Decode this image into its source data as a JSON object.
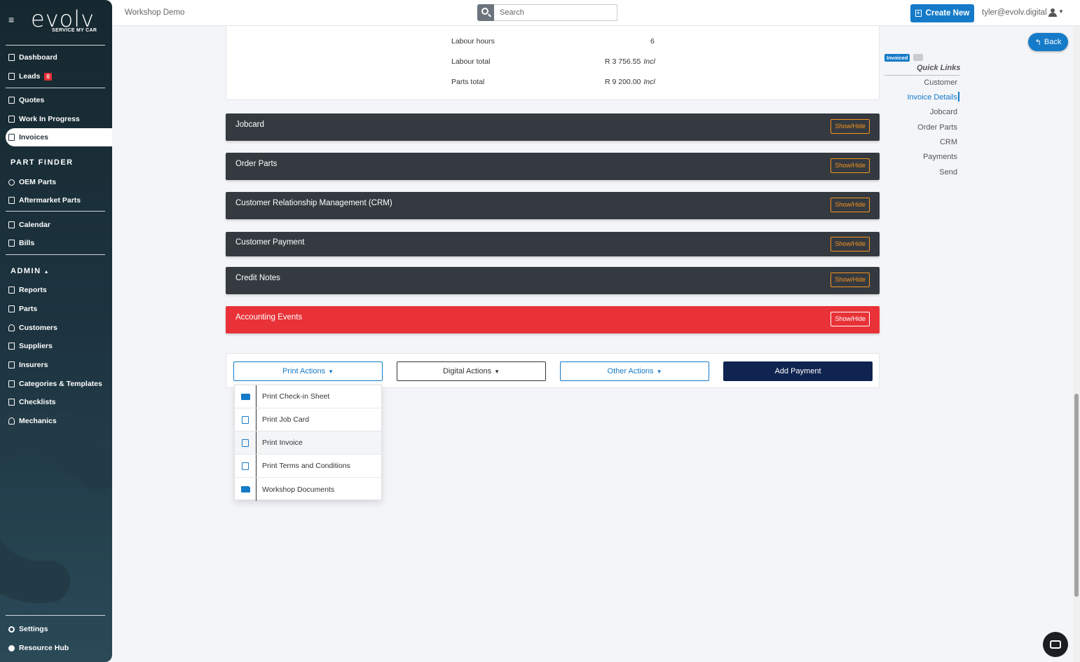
{
  "brand": {
    "name": "evolv",
    "tagline": "SERVICE MY CAR"
  },
  "sidebar": {
    "items": [
      {
        "label": "Dashboard"
      },
      {
        "label": "Leads",
        "badge": "0"
      },
      {
        "label": "Quotes"
      },
      {
        "label": "Work In Progress"
      },
      {
        "label": "Invoices"
      },
      {
        "label": "OEM Parts"
      },
      {
        "label": "Aftermarket Parts"
      },
      {
        "label": "Calendar"
      },
      {
        "label": "Bills"
      },
      {
        "label": "Reports"
      },
      {
        "label": "Parts"
      },
      {
        "label": "Customers"
      },
      {
        "label": "Suppliers"
      },
      {
        "label": "Insurers"
      },
      {
        "label": "Categories & Templates"
      },
      {
        "label": "Checklists"
      },
      {
        "label": "Mechanics"
      },
      {
        "label": "Settings"
      },
      {
        "label": "Resource Hub"
      }
    ],
    "sections": {
      "part_finder": "PART FINDER",
      "admin": "ADMIN"
    },
    "active": "Invoices"
  },
  "header": {
    "workshop": "Workshop Demo",
    "search_placeholder": "Search",
    "create_label": "Create New",
    "user_email": "tyler@evolv.digital"
  },
  "summary": {
    "rows": [
      {
        "label": "Labour hours",
        "value": "6",
        "suffix": ""
      },
      {
        "label": "Labour total",
        "value": "R 3 756.55",
        "suffix": "Incl"
      },
      {
        "label": "Parts total",
        "value": "R 9 200.00",
        "suffix": "Incl"
      }
    ]
  },
  "sections": [
    {
      "title": "Jobcard",
      "toggle": "Show/Hide"
    },
    {
      "title": "Order Parts",
      "toggle": "Show/Hide"
    },
    {
      "title": "Customer Relationship Management (CRM)",
      "toggle": "Show/Hide"
    },
    {
      "title": "Customer Payment",
      "toggle": "Show/Hide"
    },
    {
      "title": "Credit Notes",
      "toggle": "Show/Hide"
    },
    {
      "title": "Accounting Events",
      "toggle": "Show/Hide"
    }
  ],
  "actions": {
    "print": "Print Actions",
    "digital": "Digital Actions",
    "other": "Other Actions",
    "add_payment": "Add Payment"
  },
  "print_menu": [
    {
      "label": "Print Check-in Sheet",
      "icon": "id-card-icon"
    },
    {
      "label": "Print Job Card",
      "icon": "clipboard-icon"
    },
    {
      "label": "Print Invoice",
      "icon": "pdf-file-icon"
    },
    {
      "label": "Print Terms and Conditions",
      "icon": "document-icon"
    },
    {
      "label": "Workshop Documents",
      "icon": "folder-icon"
    }
  ],
  "quick_links": {
    "status": "Invoiced",
    "title": "Quick Links",
    "items": [
      "Customer",
      "Invoice Details",
      "Jobcard",
      "Order Parts",
      "CRM",
      "Payments",
      "Send"
    ],
    "active": "Invoice Details"
  },
  "back_label": "Back",
  "colors": {
    "primary": "#157bc8",
    "dark": "#343a40",
    "danger": "#e83237",
    "accent": "#f7941d",
    "navy": "#0f2450"
  }
}
